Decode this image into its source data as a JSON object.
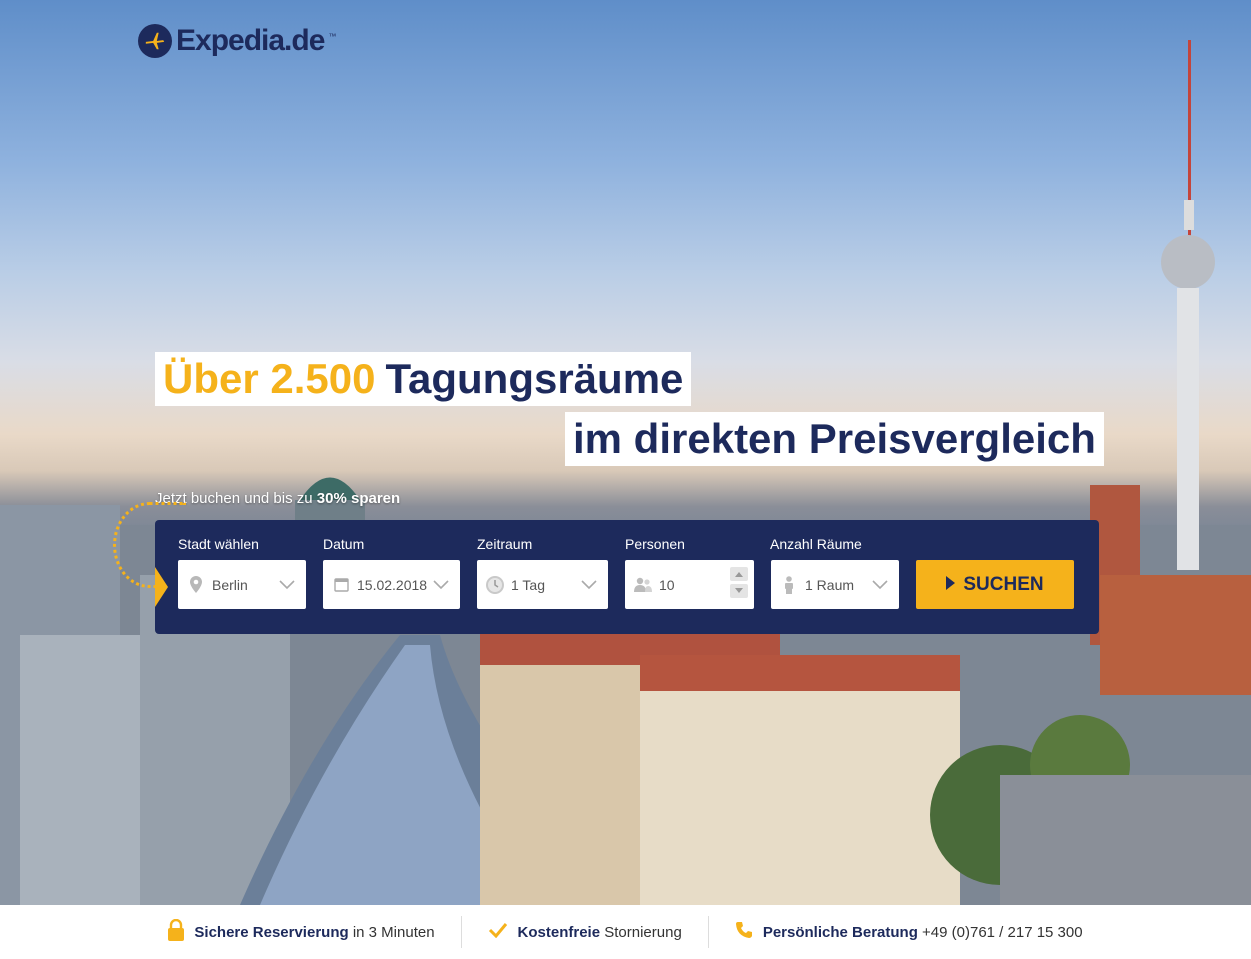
{
  "brand": {
    "name": "Expedia.de",
    "tm": "™",
    "color": "#1d2a5c",
    "accent": "#f5b21b"
  },
  "hero": {
    "headline_accent": "Über 2.500",
    "headline_rest": "Tagungsräume",
    "headline_line2": "im direkten Preisvergleich",
    "subline_text": "Jetzt buchen und bis zu",
    "subline_bold": "30% sparen"
  },
  "search": {
    "city": {
      "label": "Stadt wählen",
      "value": "Berlin",
      "icon": "map-pin-icon"
    },
    "date": {
      "label": "Datum",
      "value": "15.02.2018",
      "icon": "calendar-icon"
    },
    "duration": {
      "label": "Zeitraum",
      "value": "1 Tag",
      "icon": "clock-icon"
    },
    "persons": {
      "label": "Personen",
      "value": "10",
      "icon": "people-icon"
    },
    "rooms": {
      "label": "Anzahl Räume",
      "value": "1 Raum",
      "icon": "person-icon"
    },
    "submit_label": "SUCHEN"
  },
  "footer": {
    "items": [
      {
        "icon": "lock-icon",
        "bold": "Sichere Reservierung",
        "rest": "in 3 Minuten"
      },
      {
        "icon": "check-icon",
        "bold": "Kostenfreie",
        "rest": "Stornierung"
      },
      {
        "icon": "phone-icon",
        "bold": "Persönliche Beratung",
        "rest": "+49 (0)761 / 217 15 300"
      }
    ]
  }
}
